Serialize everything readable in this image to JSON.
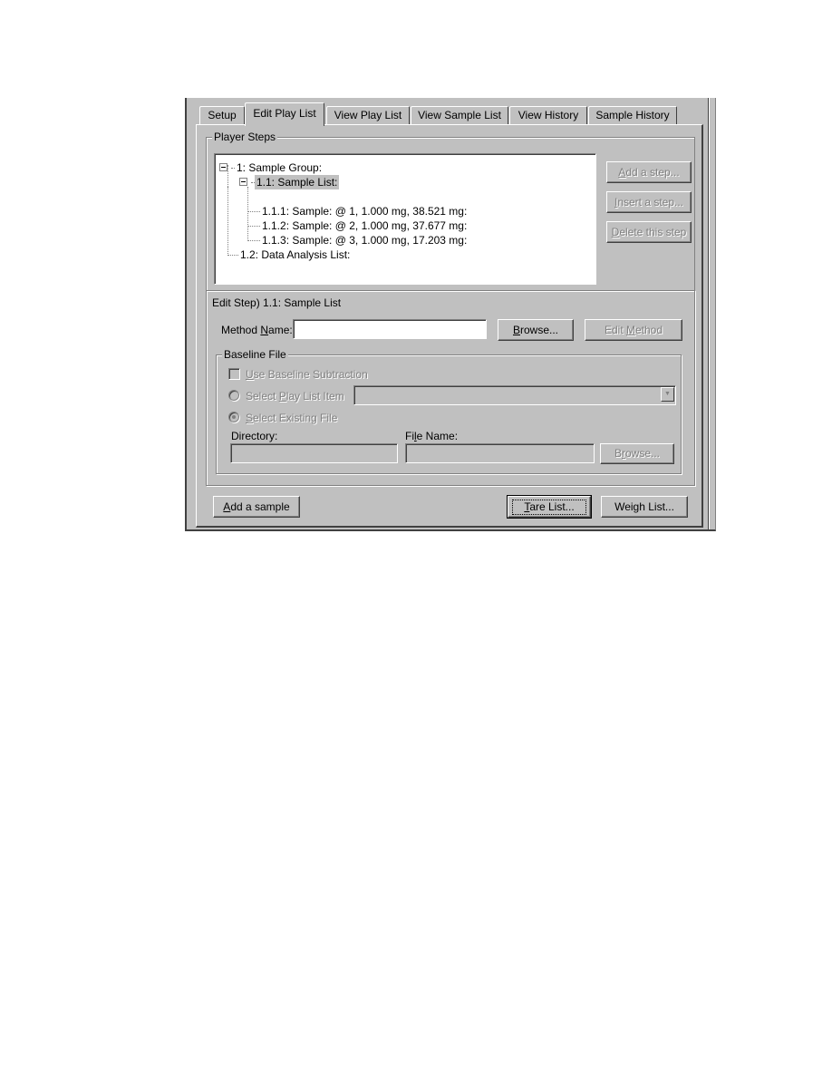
{
  "tabs": [
    {
      "label": "Setup",
      "active": false
    },
    {
      "label": "Edit Play List",
      "active": true
    },
    {
      "label": "View Play List",
      "active": false
    },
    {
      "label": "View Sample List",
      "active": false
    },
    {
      "label": "View History",
      "active": false
    },
    {
      "label": "Sample History",
      "active": false
    }
  ],
  "player_steps": {
    "legend": "Player Steps",
    "tree": [
      {
        "label": "1: Sample Group:",
        "level": 0,
        "expanded": true
      },
      {
        "label": "1.1: Sample List:",
        "level": 1,
        "expanded": true,
        "selected": true
      },
      {
        "label": "1.1.1: Sample:  @ 1, 1.000 mg, 38.521 mg:",
        "level": 2
      },
      {
        "label": "1.1.2: Sample:  @ 2, 1.000 mg, 37.677 mg:",
        "level": 2
      },
      {
        "label": "1.1.3: Sample:  @ 3, 1.000 mg, 17.203 mg:",
        "level": 2
      },
      {
        "label": "1.2: Data Analysis List:",
        "level": 1
      }
    ],
    "buttons": {
      "add_step": {
        "pre": "",
        "u": "A",
        "post": "dd a step..."
      },
      "insert_step": {
        "pre": "",
        "u": "I",
        "post": "nsert a step..."
      },
      "delete_step": {
        "pre": "",
        "u": "D",
        "post": "elete this step"
      }
    }
  },
  "edit_step": {
    "title": "Edit Step)  1.1: Sample List",
    "method_name": {
      "label_pre": "Method ",
      "label_u": "N",
      "label_post": "ame:",
      "value": ""
    },
    "browse": {
      "pre": "",
      "u": "B",
      "post": "rowse..."
    },
    "edit_method": {
      "pre": "Edit ",
      "u": "M",
      "post": "ethod"
    }
  },
  "baseline_file": {
    "legend": "Baseline File",
    "use_baseline": {
      "pre": "",
      "u": "U",
      "post": "se Baseline Subtraction",
      "checked": false
    },
    "select_play_list_item": {
      "pre": "Select ",
      "u": "P",
      "post": "lay List Item",
      "checked": false
    },
    "play_list_item_value": "",
    "select_existing_file": {
      "pre": "",
      "u": "S",
      "post": "elect Existing File",
      "checked": true
    },
    "directory": {
      "label": "Directory:",
      "value": ""
    },
    "file_name": {
      "label_pre": "Fi",
      "label_u": "l",
      "label_post": "e Name:",
      "value": ""
    },
    "browse": {
      "pre": "B",
      "u": "r",
      "post": "owse..."
    }
  },
  "footer": {
    "add_sample": {
      "pre": "",
      "u": "A",
      "post": "dd a sample"
    },
    "tare_list": {
      "pre": "",
      "u": "T",
      "post": "are List..."
    },
    "weigh_list": {
      "label": "Weigh List..."
    }
  }
}
